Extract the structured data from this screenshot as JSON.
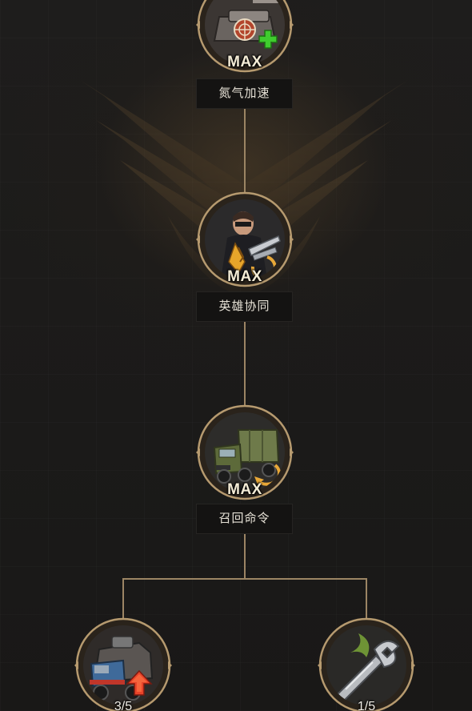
{
  "skill_tree": {
    "nodes": [
      {
        "name": "氮气加速",
        "level": "MAX",
        "icon": "tank-turret-plus-icon"
      },
      {
        "name": "英雄协同",
        "level": "MAX",
        "icon": "hero-soldier-icon"
      },
      {
        "name": "召回命令",
        "level": "MAX",
        "icon": "recall-truck-icon"
      }
    ],
    "branch_nodes": [
      {
        "level": "3/5",
        "icon": "armored-truck-upgrade-icon",
        "upgrade_available": true
      },
      {
        "level": "1/5",
        "icon": "wrench-icon",
        "upgrade_available": false
      }
    ]
  },
  "colors": {
    "connector": "#9c8564",
    "ring": "#b69a6f",
    "label_bg": "#141312",
    "label_text": "#e6e1d6",
    "upgrade_arrow": "#e8442a",
    "plus_badge": "#3fcc2e"
  }
}
